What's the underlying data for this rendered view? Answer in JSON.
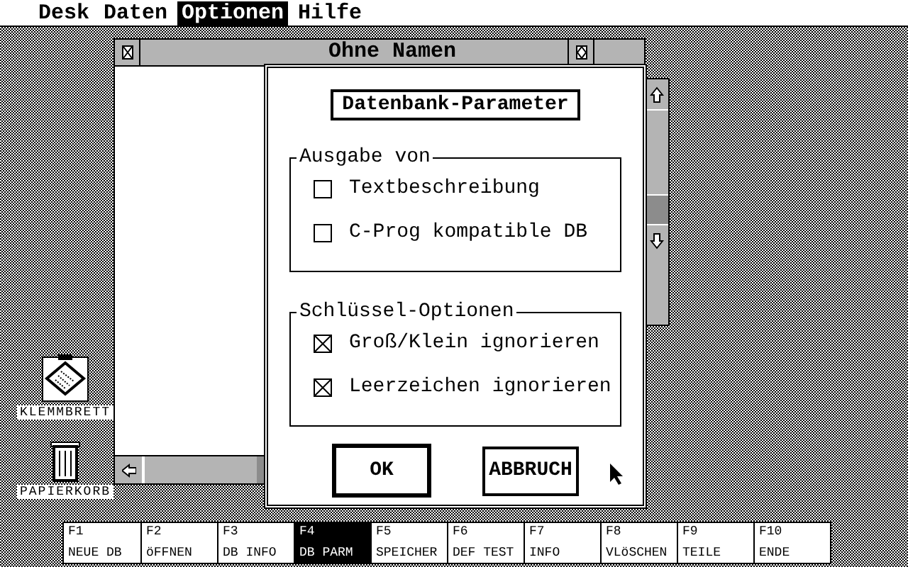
{
  "menu": [
    {
      "label": "Desk",
      "selected": false
    },
    {
      "label": "Daten",
      "selected": false
    },
    {
      "label": "Optionen",
      "selected": true
    },
    {
      "label": "Hilfe",
      "selected": false
    }
  ],
  "window": {
    "title": "Ohne Namen"
  },
  "desktop_icons": [
    {
      "kind": "clipboard",
      "label": "KLEMMBRETT"
    },
    {
      "kind": "trash",
      "label": "PAPIERKORB"
    }
  ],
  "dialog": {
    "title": "Datenbank-Parameter",
    "groups": [
      {
        "title": "Ausgabe von",
        "options": [
          {
            "label": "Textbeschreibung",
            "checked": false
          },
          {
            "label": "C-Prog kompatible DB",
            "checked": false
          }
        ]
      },
      {
        "title": "Schlüssel-Optionen",
        "options": [
          {
            "label": "Groß/Klein ignorieren",
            "checked": true
          },
          {
            "label": "Leerzeichen ignorieren",
            "checked": true
          }
        ]
      }
    ],
    "buttons": [
      {
        "label": "OK",
        "default": true
      },
      {
        "label": "ABBRUCH",
        "default": false
      }
    ]
  },
  "function_keys": [
    {
      "key": "F1",
      "label": "NEUE DB",
      "selected": false
    },
    {
      "key": "F2",
      "label": "öFFNEN",
      "selected": false
    },
    {
      "key": "F3",
      "label": "DB INFO",
      "selected": false
    },
    {
      "key": "F4",
      "label": "DB PARM",
      "selected": true
    },
    {
      "key": "F5",
      "label": "SPEICHER",
      "selected": false
    },
    {
      "key": "F6",
      "label": "DEF TEST",
      "selected": false
    },
    {
      "key": "F7",
      "label": "INFO",
      "selected": false
    },
    {
      "key": "F8",
      "label": "VLöSCHEN",
      "selected": false
    },
    {
      "key": "F9",
      "label": "TEILE",
      "selected": false
    },
    {
      "key": "F10",
      "label": "ENDE",
      "selected": false
    }
  ]
}
